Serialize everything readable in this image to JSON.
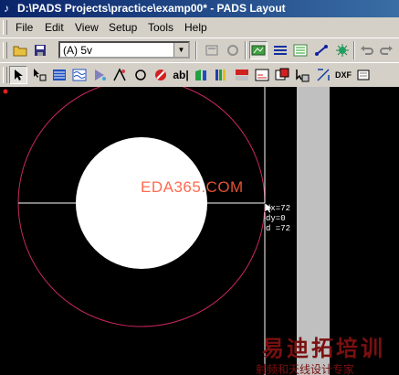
{
  "window": {
    "title": "D:\\PADS Projects\\practice\\examp00* - PADS Layout"
  },
  "menu": {
    "items": [
      "File",
      "Edit",
      "View",
      "Setup",
      "Tools",
      "Help"
    ]
  },
  "toolbar": {
    "layer_value": "(A) 5v"
  },
  "canvas": {
    "readout_dx": "dx=72",
    "readout_dy": "dy=0",
    "readout_d": "d =72",
    "watermark": "EDA365.COM",
    "watermark_cn_large": "易迪拓培训",
    "watermark_cn_small": "射频和天线设计专家"
  },
  "colors": {
    "title_start": "#0a246a",
    "title_end": "#3a6ea5",
    "circle": "#c8285a",
    "canvas": "#000000",
    "pad": "#ffffff"
  }
}
